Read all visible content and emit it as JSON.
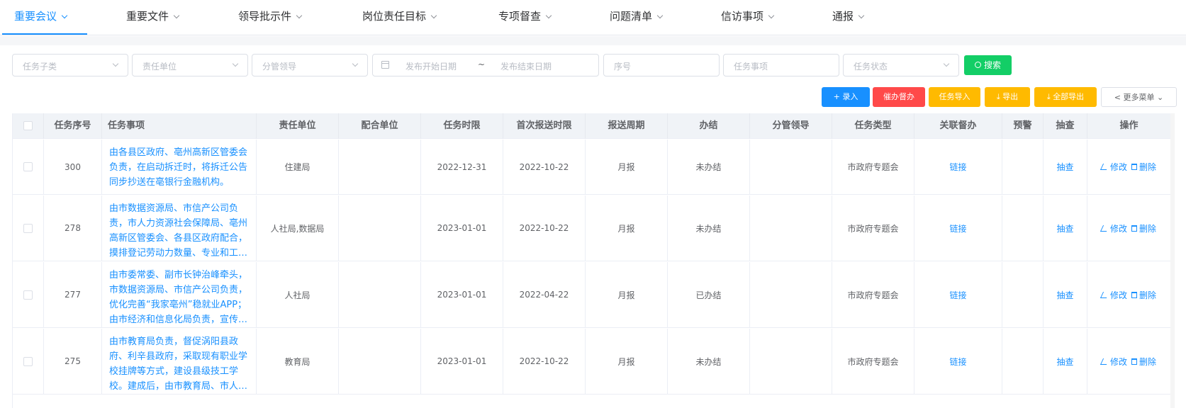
{
  "nav": {
    "tabs": [
      {
        "label": "重要会议",
        "active": true
      },
      {
        "label": "重要文件"
      },
      {
        "label": "领导批示件"
      },
      {
        "label": "岗位责任目标"
      },
      {
        "label": "专项督查"
      },
      {
        "label": "问题清单"
      },
      {
        "label": "信访事项"
      },
      {
        "label": "通报"
      }
    ]
  },
  "filters": {
    "task_subtype": "任务子类",
    "resp_unit": "责任单位",
    "leader": "分管领导",
    "date_start": "发布开始日期",
    "date_sep": "~",
    "date_end": "发布结束日期",
    "seq": "序号",
    "task_item": "任务事项",
    "status": "任务状态",
    "search": "搜索"
  },
  "actions": {
    "add": "+ 录入",
    "assist": "催办督办",
    "import": "任务导入",
    "export": "导出",
    "export_all": "全部导出",
    "more": "更多菜单"
  },
  "table": {
    "headers": {
      "seq": "任务序号",
      "task": "任务事项",
      "resp": "责任单位",
      "coop": "配合单位",
      "deadline": "任务时限",
      "first": "首次报送时限",
      "cycle": "报送周期",
      "done": "办结",
      "leader": "分管领导",
      "type": "任务类型",
      "linked": "关联督办",
      "warn": "预警",
      "check": "抽查",
      "ops": "操作"
    },
    "rows": [
      {
        "seq": "300",
        "task": "由各县区政府、亳州高新区管委会负责，在启动拆迁时，将拆迁公告同步抄送在亳银行金融机构。",
        "resp": "住建局",
        "coop": "",
        "deadline": "2022-12-31",
        "first": "2022-10-22",
        "cycle": "月报",
        "done": "未办结",
        "leader": "",
        "type": "市政府专题会",
        "linked": "链接",
        "warn": "",
        "check": "抽查",
        "edit": "修改",
        "del": "删除"
      },
      {
        "seq": "278",
        "task": "由市数据资源局、市信产公司负责，市人力资源社会保障局、亳州高新区管委会、各县区政府配合，摸排登记劳动力数量、专业和工作意愿等信息。",
        "resp": "人社局,数据局",
        "coop": "",
        "deadline": "2023-01-01",
        "first": "2022-10-22",
        "cycle": "月报",
        "done": "未办结",
        "leader": "",
        "type": "市政府专题会",
        "linked": "链接",
        "warn": "",
        "check": "抽查",
        "edit": "修改",
        "del": "删除"
      },
      {
        "seq": "277",
        "task": "由市委常委、副市长钟治峰牵头，市数据资源局、市信产公司负责，优化完善“我家亳州”稳就业APP；由市经济和信息化局负责，宣传推广。",
        "resp": "人社局",
        "coop": "",
        "deadline": "2023-01-01",
        "first": "2022-04-22",
        "cycle": "月报",
        "done": "已办结",
        "leader": "",
        "type": "市政府专题会",
        "linked": "链接",
        "warn": "",
        "check": "抽查",
        "edit": "修改",
        "del": "删除"
      },
      {
        "seq": "275",
        "task": "由市教育局负责，督促涡阳县政府、利辛县政府，采取现有职业学校挂牌等方式，建设县级技工学校。建成后，由市教育局、市人社局负责。",
        "resp": "教育局",
        "coop": "",
        "deadline": "2023-01-01",
        "first": "2022-10-22",
        "cycle": "月报",
        "done": "未办结",
        "leader": "",
        "type": "市政府专题会",
        "linked": "链接",
        "warn": "",
        "check": "抽查",
        "edit": "修改",
        "del": "删除"
      }
    ]
  }
}
